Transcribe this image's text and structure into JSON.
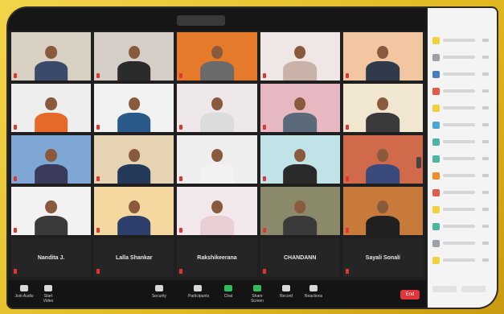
{
  "meeting": {
    "view_label": "",
    "top_right": ""
  },
  "tiles": [
    {
      "scene": "#d8d0c2",
      "body": "#3a4a6a"
    },
    {
      "scene": "#d6cfc8",
      "body": "#2b2b2b"
    },
    {
      "scene": "#e57a2a",
      "body": "#6a6a6a"
    },
    {
      "scene": "#f0e6e6",
      "body": "#c9b3a8"
    },
    {
      "scene": "#f2c6a0",
      "body": "#2f3b4a"
    },
    {
      "scene": "#eeeeee",
      "body": "#e56a2a"
    },
    {
      "scene": "#f2f2f2",
      "body": "#2a5a8a"
    },
    {
      "scene": "#efe8ea",
      "body": "#dcdcdc"
    },
    {
      "scene": "#e7b7c2",
      "body": "#5a6a7a"
    },
    {
      "scene": "#f1e6cf",
      "body": "#3a3a3a"
    },
    {
      "scene": "#7fa7d6",
      "body": "#3a3a5a"
    },
    {
      "scene": "#e6d3b2",
      "body": "#253a5a"
    },
    {
      "scene": "#eeeeee",
      "body": "#f2f2f2"
    },
    {
      "scene": "#bfe3e6",
      "body": "#2a2a2a"
    },
    {
      "scene": "#d06a4a",
      "body": "#3a4a7a"
    },
    {
      "scene": "#f2f2f2",
      "body": "#3a3a3a"
    },
    {
      "scene": "#f4d8a0",
      "body": "#2d3f6a"
    },
    {
      "scene": "#f2e8ec",
      "body": "#e8cfd3"
    },
    {
      "scene": "#8a8a6a",
      "body": "#3a3a3a"
    },
    {
      "scene": "#c77a3a",
      "body": "#202020"
    }
  ],
  "name_row": [
    {
      "label": "Nandita J."
    },
    {
      "label": "Lalla Shankar"
    },
    {
      "label": "Rakshikeerana"
    },
    {
      "label": "CHANDANN"
    },
    {
      "label": "Sayali Sonali"
    }
  ],
  "toolbar": {
    "items": [
      {
        "label": "Join Audio"
      },
      {
        "label": "Start Video"
      },
      {
        "label": "Security"
      },
      {
        "label": "Participants"
      },
      {
        "label": "Chat"
      },
      {
        "label": "Share Screen"
      },
      {
        "label": "Record"
      },
      {
        "label": "Reactions"
      }
    ],
    "end_label": "End"
  },
  "participants_panel": {
    "title": "",
    "avatars": [
      "#f2d23a",
      "#9aa0a6",
      "#4a7cc0",
      "#e25a4a",
      "#f2d23a",
      "#4aa6d6",
      "#49b6a0",
      "#49b6a0",
      "#f08a2a",
      "#e25a4a",
      "#f2d23a",
      "#49b6a0",
      "#9aa0a6",
      "#f2d23a"
    ]
  }
}
